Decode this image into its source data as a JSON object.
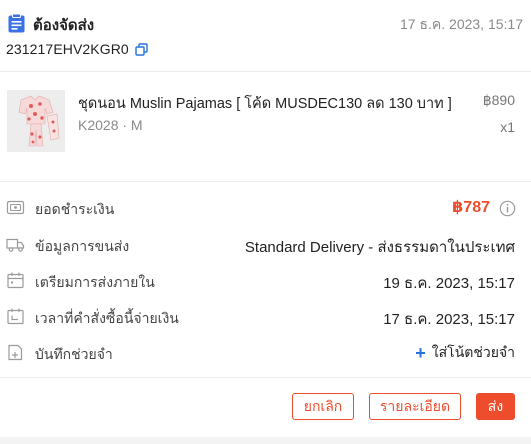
{
  "header": {
    "status_title": "ต้องจัดส่ง",
    "order_time": "17 ธ.ค. 2023, 15:17",
    "order_id": "231217EHV2KGR0",
    "status_icon": "clipboard-icon",
    "copy_icon": "copy-icon"
  },
  "product": {
    "name": "ชุดนอน Muslin Pajamas [ โค้ด MUSDEC130 ลด 130 บาท ]",
    "variant": "K2028 · M",
    "price": "฿890",
    "quantity": "x1",
    "thumbnail_icon": "product-image"
  },
  "details": {
    "amount": {
      "label": "ยอดชำระเงิน",
      "value": "฿787",
      "icon": "wallet-icon",
      "help_icon": "info-icon"
    },
    "shipping": {
      "label": "ข้อมูลการขนส่ง",
      "value": "Standard Delivery - ส่งธรรมดาในประเทศ",
      "icon": "truck-icon"
    },
    "prepare": {
      "label": "เตรียมการส่งภายใน",
      "value": "19 ธ.ค. 2023, 15:17",
      "icon": "calendar-icon"
    },
    "paid_time": {
      "label": "เวลาที่คำสั่งซื้อนี้จ่ายเงิน",
      "value": "17 ธ.ค. 2023, 15:17",
      "icon": "calendar-check-icon"
    },
    "note": {
      "label": "บันทึกช่วยจำ",
      "action": "ใส่โน้ตช่วยจำ",
      "icon": "note-icon"
    }
  },
  "actions": {
    "cancel": "ยกเลิก",
    "detail": "รายละเอียด",
    "ship": "ส่ง"
  },
  "colors": {
    "accent": "#ee4d2d",
    "link": "#2673dd",
    "muted": "#8a8a8a"
  }
}
